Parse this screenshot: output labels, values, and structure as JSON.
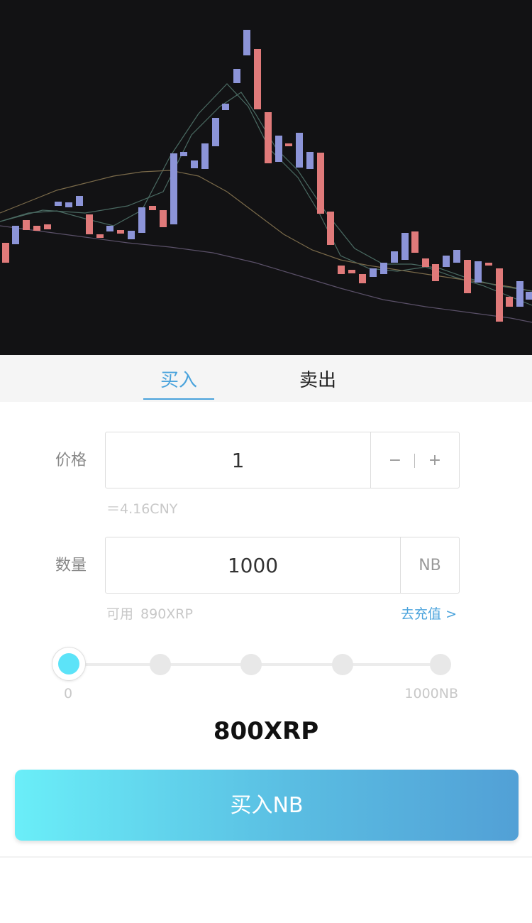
{
  "chart": {
    "background": "#121214",
    "colors": {
      "up": "#e07a7a",
      "down": "#8c94d8",
      "ma_short": "#4a6a62",
      "ma_mid": "#7a6a4a",
      "ma_long": "#5a5068"
    }
  },
  "tabs": {
    "buy_label": "买入",
    "sell_label": "卖出",
    "active": "buy"
  },
  "form": {
    "price_label": "价格",
    "price_value": "1",
    "stepper_minus": "−",
    "stepper_plus": "+",
    "price_hint": "＝4.16CNY",
    "quantity_label": "数量",
    "quantity_value": "1000",
    "quantity_unit": "NB",
    "available_label": "可用",
    "available_value": "890XRP",
    "recharge_label": "去充值 >"
  },
  "slider": {
    "min_label": "0",
    "max_label": "1000NB",
    "level": 0,
    "steps": 5
  },
  "summary": {
    "total": "800XRP"
  },
  "action": {
    "buy_button_label": "买入NB"
  },
  "colors": {
    "accent": "#4aa3dc",
    "knob": "#5ce3f8",
    "button_gradient_start": "#6aeef8",
    "button_gradient_end": "#52a0d6"
  }
}
